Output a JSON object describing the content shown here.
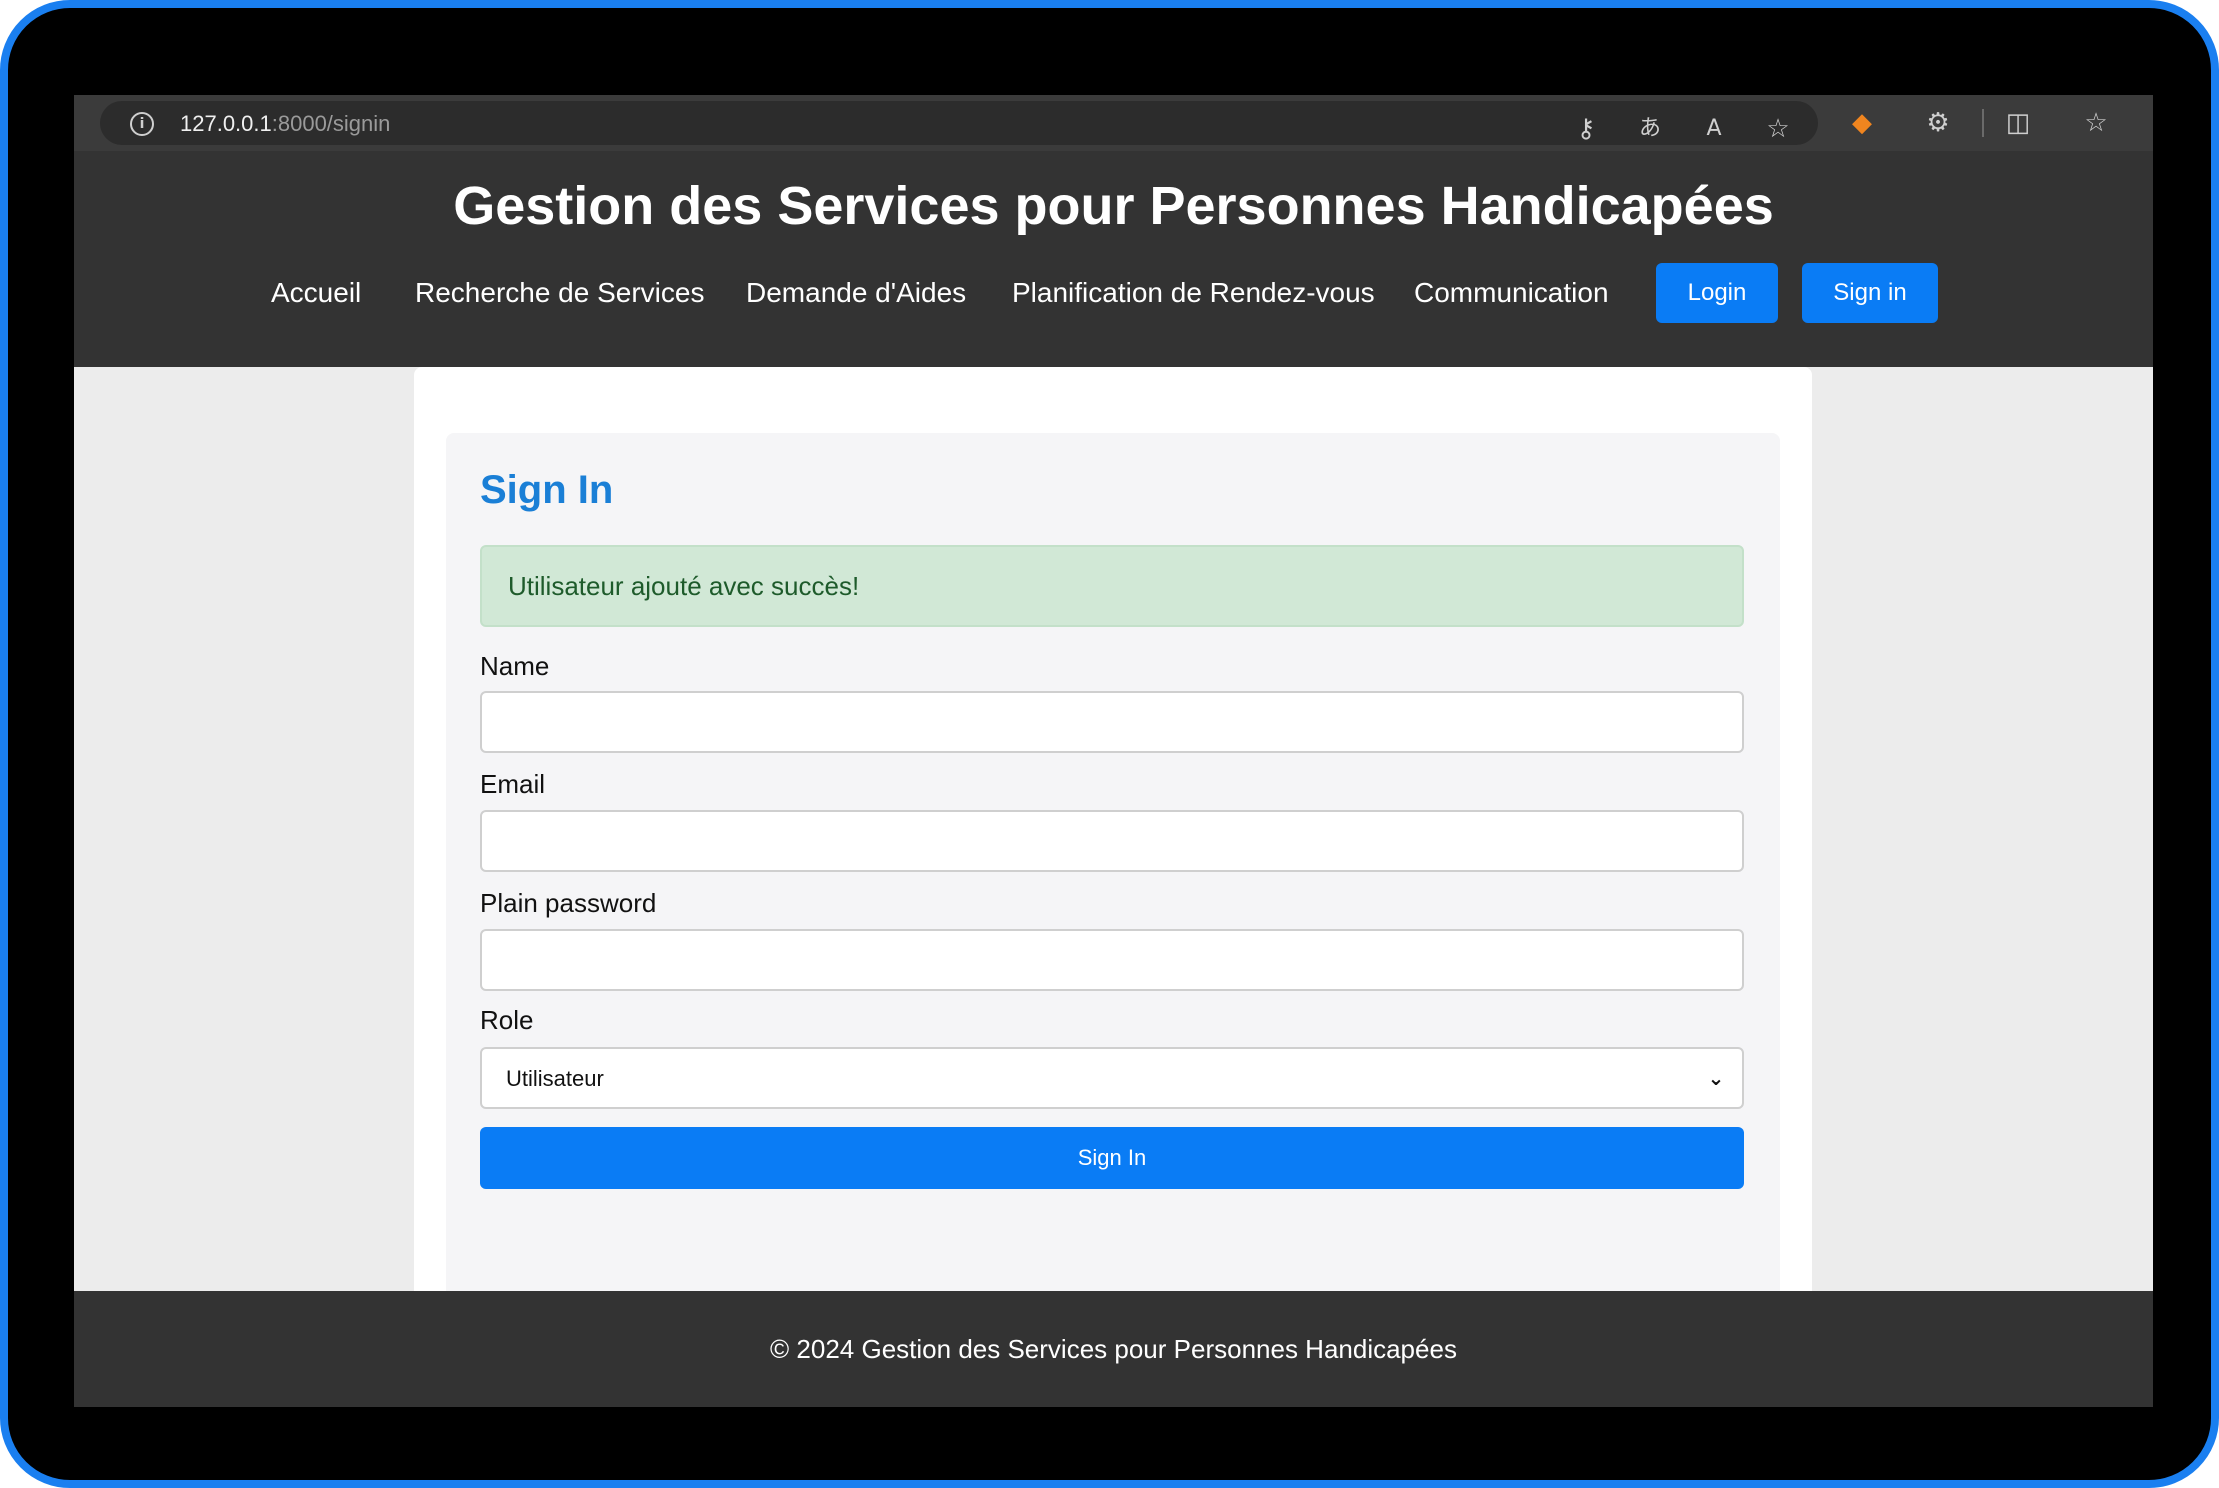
{
  "browser": {
    "url_host": "127.0.0.1",
    "url_path": ":8000/signin",
    "icons": [
      "info-icon",
      "key-icon",
      "translate-icon",
      "read-aloud-icon",
      "favorite-star-icon",
      "metamask-extension-icon",
      "extensions-icon",
      "split-screen-icon",
      "favorites-list-icon"
    ]
  },
  "header": {
    "title": "Gestion des Services pour Personnes Handicapées",
    "nav": [
      {
        "label": "Accueil"
      },
      {
        "label": "Recherche de Services"
      },
      {
        "label": "Demande d'Aides"
      },
      {
        "label": "Planification de Rendez-vous"
      },
      {
        "label": "Communication"
      }
    ],
    "login_label": "Login",
    "signin_label": "Sign in"
  },
  "form": {
    "title": "Sign In",
    "alert": "Utilisateur ajouté avec succès!",
    "name_label": "Name",
    "name_value": "",
    "email_label": "Email",
    "email_value": "",
    "password_label": "Plain password",
    "password_value": "",
    "role_label": "Role",
    "role_value": "Utilisateur",
    "submit_label": "Sign In"
  },
  "footer": {
    "text": "© 2024 Gestion des Services pour Personnes Handicapées"
  },
  "colors": {
    "accent": "#0a7cf5",
    "title_blue": "#1a7fd6",
    "header_bg": "#333333",
    "alert_bg": "#d1e8d6",
    "alert_text": "#1e5b2b",
    "device_border": "#1a7ff0"
  }
}
